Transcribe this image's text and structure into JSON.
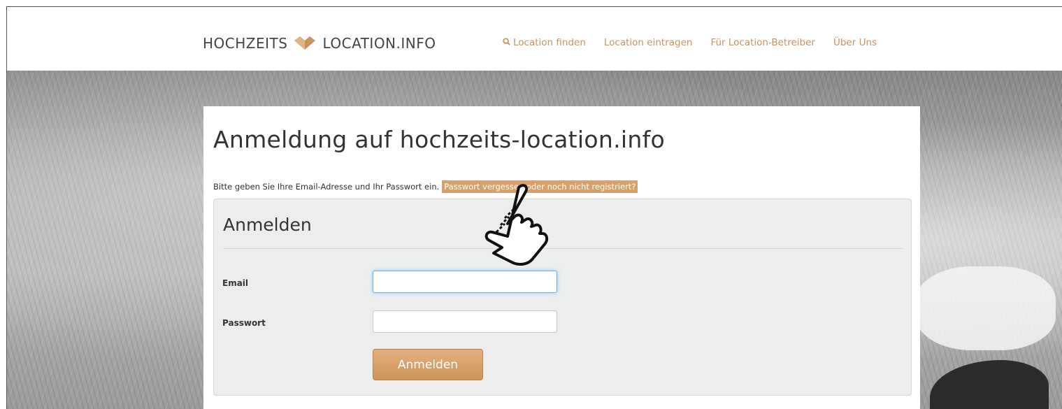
{
  "header": {
    "logo_left": "HOCHZEITS",
    "logo_right": "LOCATION.INFO",
    "nav": [
      {
        "label": "Location finden",
        "icon": "search-icon"
      },
      {
        "label": "Location eintragen"
      },
      {
        "label": "Für Location-Betreiber"
      },
      {
        "label": "Über Uns"
      }
    ]
  },
  "main": {
    "title": "Anmeldung auf hochzeits-location.info",
    "intro_text": "Bitte geben Sie Ihre Email-Adresse und Ihr Passwort ein.",
    "intro_link": "Passwort vergessen oder noch nicht registriert?"
  },
  "form": {
    "heading": "Anmelden",
    "email_label": "Email",
    "email_value": "",
    "password_label": "Passwort",
    "password_value": "",
    "submit_label": "Anmelden"
  },
  "colors": {
    "accent": "#c99360",
    "link_highlight": "#d5a06c",
    "button": "#d9a26c"
  },
  "overlay": {
    "cursor_icon": "hand-pointer-icon"
  }
}
